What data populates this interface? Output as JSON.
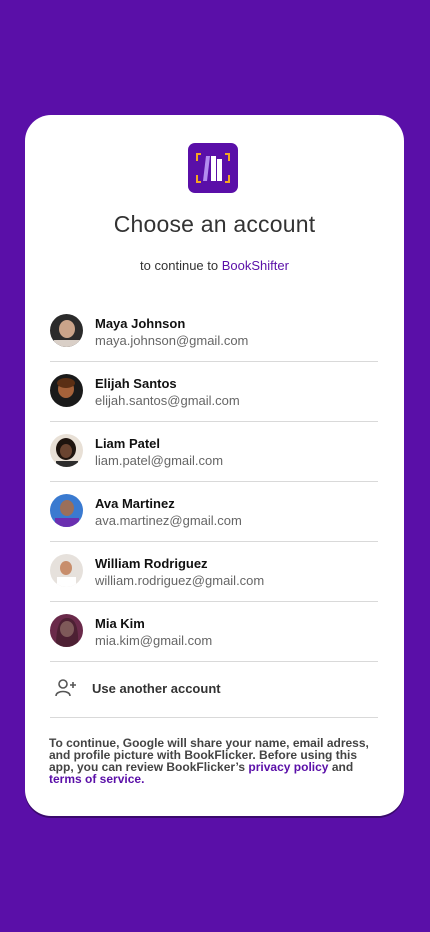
{
  "colors": {
    "background": "#5a0fa8",
    "card": "#ffffff",
    "accent": "#5a0fa8",
    "logo_bracket": "#f5a623"
  },
  "logo": {
    "icon": "books-logo-icon"
  },
  "title": "Choose an account",
  "subtitle": {
    "prefix": "to continue to",
    "app_name": "BookShifter"
  },
  "accounts": [
    {
      "name": "Maya Johnson",
      "email": "maya.johnson@gmail.com",
      "avatar_color": "#7a6a5e"
    },
    {
      "name": "Elijah Santos",
      "email": "elijah.santos@gmail.com",
      "avatar_color": "#6b3a22"
    },
    {
      "name": "Liam Patel",
      "email": "liam.patel@gmail.com",
      "avatar_color": "#3b2a20"
    },
    {
      "name": "Ava Martinez",
      "email": "ava.martinez@gmail.com",
      "avatar_color": "#3c5fa8"
    },
    {
      "name": "William Rodriguez",
      "email": "william.rodriguez@gmail.com",
      "avatar_color": "#d9d2cc"
    },
    {
      "name": "Mia Kim",
      "email": "mia.kim@gmail.com",
      "avatar_color": "#8a4a6a"
    }
  ],
  "use_another": {
    "label": "Use another account",
    "icon": "add-person-icon"
  },
  "disclaimer": {
    "text": "To continue, Google will share your name, email adress, and profile picture with BookFlicker. Before using this app, you can review BookFlicker’s",
    "privacy_link": "privacy policy",
    "and": "and",
    "terms_link": "terms of service",
    "end": "."
  }
}
